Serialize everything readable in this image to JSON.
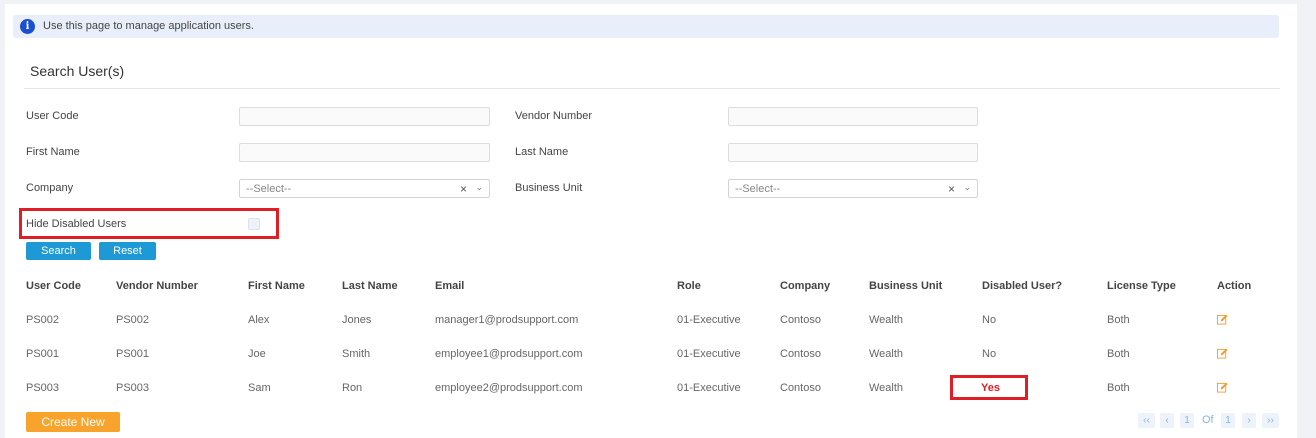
{
  "info": {
    "message": "Use this page to manage application users."
  },
  "search": {
    "title": "Search User(s)",
    "user_code_label": "User Code",
    "vendor_number_label": "Vendor Number",
    "first_name_label": "First Name",
    "last_name_label": "Last Name",
    "company_label": "Company",
    "company_value": "--Select--",
    "business_unit_label": "Business Unit",
    "business_unit_value": "--Select--",
    "hide_disabled_label": "Hide Disabled Users",
    "hide_disabled_checked": false,
    "search_button": "Search",
    "reset_button": "Reset",
    "clear_glyph": "×",
    "chevron_glyph": "⌄"
  },
  "table": {
    "headers": [
      "User Code",
      "Vendor Number",
      "First Name",
      "Last Name",
      "Email",
      "Role",
      "Company",
      "Business Unit",
      "Disabled User?",
      "License Type",
      "Action"
    ],
    "rows": [
      [
        "PS002",
        "PS002",
        "Alex",
        "Jones",
        "manager1@prodsupport.com",
        "01-Executive",
        "Contoso",
        "Wealth",
        "No",
        "Both"
      ],
      [
        "PS001",
        "PS001",
        "Joe",
        "Smith",
        "employee1@prodsupport.com",
        "01-Executive",
        "Contoso",
        "Wealth",
        "No",
        "Both"
      ],
      [
        "PS003",
        "PS003",
        "Sam",
        "Ron",
        "employee2@prodsupport.com",
        "01-Executive",
        "Contoso",
        "Wealth",
        "Yes",
        "Both"
      ]
    ]
  },
  "footer": {
    "create_button": "Create New",
    "pagination": {
      "first": "‹‹",
      "prev": "‹",
      "current": "1",
      "of": "Of",
      "total": "1",
      "next": "›",
      "last": "››"
    }
  },
  "colors": {
    "primary": "#1d9ad6",
    "accent": "#f7a32c",
    "highlight": "#e01e26",
    "info_bg": "#e8eefa"
  }
}
